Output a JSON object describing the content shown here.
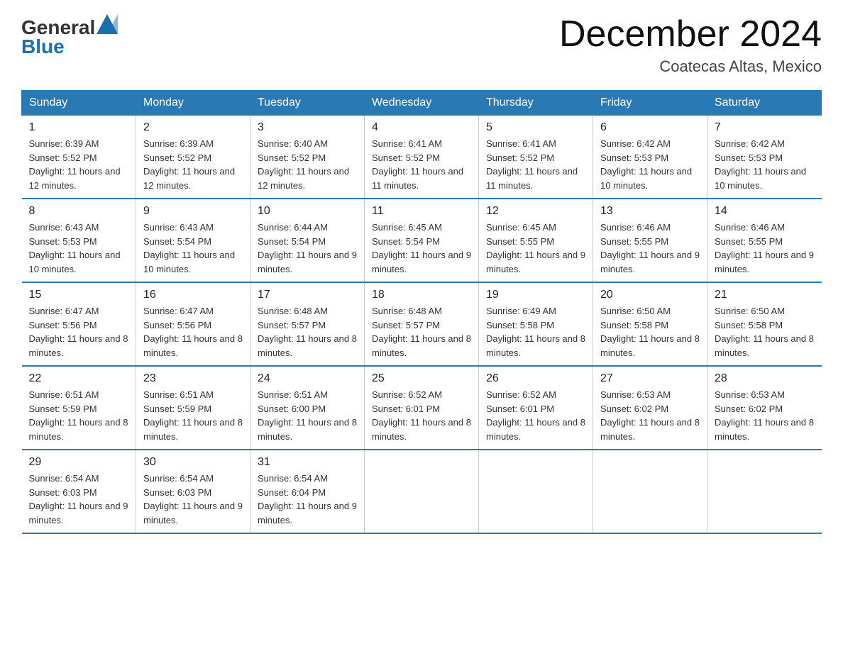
{
  "header": {
    "logo_general": "General",
    "logo_blue": "Blue",
    "month_title": "December 2024",
    "location": "Coatecas Altas, Mexico"
  },
  "calendar": {
    "days_of_week": [
      "Sunday",
      "Monday",
      "Tuesday",
      "Wednesday",
      "Thursday",
      "Friday",
      "Saturday"
    ],
    "weeks": [
      [
        {
          "day": "1",
          "sunrise": "6:39 AM",
          "sunset": "5:52 PM",
          "daylight": "11 hours and 12 minutes."
        },
        {
          "day": "2",
          "sunrise": "6:39 AM",
          "sunset": "5:52 PM",
          "daylight": "11 hours and 12 minutes."
        },
        {
          "day": "3",
          "sunrise": "6:40 AM",
          "sunset": "5:52 PM",
          "daylight": "11 hours and 12 minutes."
        },
        {
          "day": "4",
          "sunrise": "6:41 AM",
          "sunset": "5:52 PM",
          "daylight": "11 hours and 11 minutes."
        },
        {
          "day": "5",
          "sunrise": "6:41 AM",
          "sunset": "5:52 PM",
          "daylight": "11 hours and 11 minutes."
        },
        {
          "day": "6",
          "sunrise": "6:42 AM",
          "sunset": "5:53 PM",
          "daylight": "11 hours and 10 minutes."
        },
        {
          "day": "7",
          "sunrise": "6:42 AM",
          "sunset": "5:53 PM",
          "daylight": "11 hours and 10 minutes."
        }
      ],
      [
        {
          "day": "8",
          "sunrise": "6:43 AM",
          "sunset": "5:53 PM",
          "daylight": "11 hours and 10 minutes."
        },
        {
          "day": "9",
          "sunrise": "6:43 AM",
          "sunset": "5:54 PM",
          "daylight": "11 hours and 10 minutes."
        },
        {
          "day": "10",
          "sunrise": "6:44 AM",
          "sunset": "5:54 PM",
          "daylight": "11 hours and 9 minutes."
        },
        {
          "day": "11",
          "sunrise": "6:45 AM",
          "sunset": "5:54 PM",
          "daylight": "11 hours and 9 minutes."
        },
        {
          "day": "12",
          "sunrise": "6:45 AM",
          "sunset": "5:55 PM",
          "daylight": "11 hours and 9 minutes."
        },
        {
          "day": "13",
          "sunrise": "6:46 AM",
          "sunset": "5:55 PM",
          "daylight": "11 hours and 9 minutes."
        },
        {
          "day": "14",
          "sunrise": "6:46 AM",
          "sunset": "5:55 PM",
          "daylight": "11 hours and 9 minutes."
        }
      ],
      [
        {
          "day": "15",
          "sunrise": "6:47 AM",
          "sunset": "5:56 PM",
          "daylight": "11 hours and 8 minutes."
        },
        {
          "day": "16",
          "sunrise": "6:47 AM",
          "sunset": "5:56 PM",
          "daylight": "11 hours and 8 minutes."
        },
        {
          "day": "17",
          "sunrise": "6:48 AM",
          "sunset": "5:57 PM",
          "daylight": "11 hours and 8 minutes."
        },
        {
          "day": "18",
          "sunrise": "6:48 AM",
          "sunset": "5:57 PM",
          "daylight": "11 hours and 8 minutes."
        },
        {
          "day": "19",
          "sunrise": "6:49 AM",
          "sunset": "5:58 PM",
          "daylight": "11 hours and 8 minutes."
        },
        {
          "day": "20",
          "sunrise": "6:50 AM",
          "sunset": "5:58 PM",
          "daylight": "11 hours and 8 minutes."
        },
        {
          "day": "21",
          "sunrise": "6:50 AM",
          "sunset": "5:58 PM",
          "daylight": "11 hours and 8 minutes."
        }
      ],
      [
        {
          "day": "22",
          "sunrise": "6:51 AM",
          "sunset": "5:59 PM",
          "daylight": "11 hours and 8 minutes."
        },
        {
          "day": "23",
          "sunrise": "6:51 AM",
          "sunset": "5:59 PM",
          "daylight": "11 hours and 8 minutes."
        },
        {
          "day": "24",
          "sunrise": "6:51 AM",
          "sunset": "6:00 PM",
          "daylight": "11 hours and 8 minutes."
        },
        {
          "day": "25",
          "sunrise": "6:52 AM",
          "sunset": "6:01 PM",
          "daylight": "11 hours and 8 minutes."
        },
        {
          "day": "26",
          "sunrise": "6:52 AM",
          "sunset": "6:01 PM",
          "daylight": "11 hours and 8 minutes."
        },
        {
          "day": "27",
          "sunrise": "6:53 AM",
          "sunset": "6:02 PM",
          "daylight": "11 hours and 8 minutes."
        },
        {
          "day": "28",
          "sunrise": "6:53 AM",
          "sunset": "6:02 PM",
          "daylight": "11 hours and 8 minutes."
        }
      ],
      [
        {
          "day": "29",
          "sunrise": "6:54 AM",
          "sunset": "6:03 PM",
          "daylight": "11 hours and 9 minutes."
        },
        {
          "day": "30",
          "sunrise": "6:54 AM",
          "sunset": "6:03 PM",
          "daylight": "11 hours and 9 minutes."
        },
        {
          "day": "31",
          "sunrise": "6:54 AM",
          "sunset": "6:04 PM",
          "daylight": "11 hours and 9 minutes."
        },
        null,
        null,
        null,
        null
      ]
    ]
  }
}
